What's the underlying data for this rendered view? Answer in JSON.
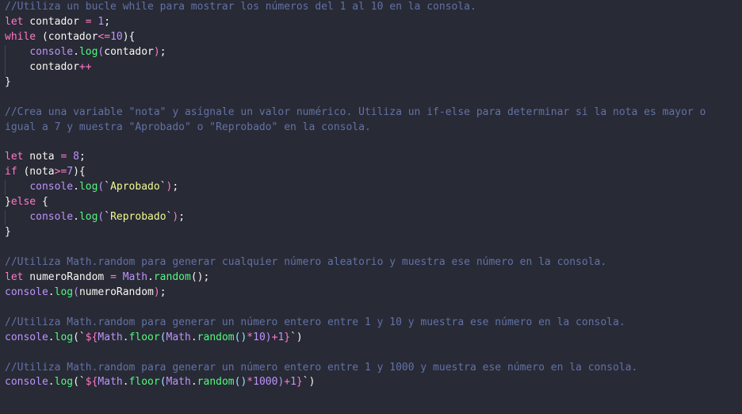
{
  "theme": {
    "background": "#282a36",
    "comment": "#6272a4",
    "keyword": "#ff79c6",
    "number": "#bd93f9",
    "function": "#50fa7b",
    "string": "#f1fa8c"
  },
  "lines": [
    [
      [
        "c",
        "//Utiliza un bucle while para mostrar los números del 1 al 10 en la consola."
      ]
    ],
    [
      [
        "k",
        "let"
      ],
      [
        "t",
        " contador "
      ],
      [
        "k",
        "="
      ],
      [
        "t",
        " "
      ],
      [
        "p",
        "1"
      ],
      [
        "t",
        ";"
      ]
    ],
    [
      [
        "k",
        "while"
      ],
      [
        "t",
        " (contador"
      ],
      [
        "k",
        "<="
      ],
      [
        "p",
        "10"
      ],
      [
        "t",
        "){"
      ]
    ],
    [
      [
        "t",
        "    "
      ],
      [
        "p",
        "console"
      ],
      [
        "t",
        "."
      ],
      [
        "f",
        "log"
      ],
      [
        "p",
        "("
      ],
      [
        "t",
        "contador"
      ],
      [
        "k",
        ")"
      ],
      [
        "t",
        ";"
      ]
    ],
    [
      [
        "t",
        "    contador"
      ],
      [
        "k",
        "++"
      ]
    ],
    [
      [
        "t",
        "}"
      ]
    ],
    [],
    [
      [
        "c",
        "//Crea una variable \"nota\" y asígnale un valor numérico. Utiliza un if-else para determinar si la nota es mayor o"
      ]
    ],
    [
      [
        "c",
        "igual a 7 y muestra \"Aprobado\" o \"Reprobado\" en la consola."
      ]
    ],
    [],
    [
      [
        "k",
        "let"
      ],
      [
        "t",
        " nota "
      ],
      [
        "k",
        "="
      ],
      [
        "t",
        " "
      ],
      [
        "p",
        "8"
      ],
      [
        "t",
        ";"
      ]
    ],
    [
      [
        "k",
        "if"
      ],
      [
        "t",
        " (nota"
      ],
      [
        "k",
        ">="
      ],
      [
        "p",
        "7"
      ],
      [
        "t",
        "){"
      ]
    ],
    [
      [
        "t",
        "    "
      ],
      [
        "p",
        "console"
      ],
      [
        "t",
        "."
      ],
      [
        "f",
        "log"
      ],
      [
        "p",
        "("
      ],
      [
        "t",
        "`"
      ],
      [
        "s",
        "Aprobado"
      ],
      [
        "t",
        "`"
      ],
      [
        "k",
        ")"
      ],
      [
        "t",
        ";"
      ]
    ],
    [
      [
        "t",
        "}"
      ],
      [
        "k",
        "else"
      ],
      [
        "t",
        " {"
      ]
    ],
    [
      [
        "t",
        "    "
      ],
      [
        "p",
        "console"
      ],
      [
        "t",
        "."
      ],
      [
        "f",
        "log"
      ],
      [
        "p",
        "("
      ],
      [
        "t",
        "`"
      ],
      [
        "s",
        "Reprobado"
      ],
      [
        "t",
        "`"
      ],
      [
        "k",
        ")"
      ],
      [
        "t",
        ";"
      ]
    ],
    [
      [
        "t",
        "}"
      ]
    ],
    [],
    [
      [
        "c",
        "//Utiliza Math.random para generar cualquier número aleatorio y muestra ese número en la consola."
      ]
    ],
    [
      [
        "k",
        "let"
      ],
      [
        "t",
        " numeroRandom "
      ],
      [
        "k",
        "="
      ],
      [
        "t",
        " "
      ],
      [
        "p",
        "Math"
      ],
      [
        "t",
        "."
      ],
      [
        "f",
        "random"
      ],
      [
        "t",
        "();"
      ]
    ],
    [
      [
        "p",
        "console"
      ],
      [
        "t",
        "."
      ],
      [
        "f",
        "log"
      ],
      [
        "p",
        "("
      ],
      [
        "t",
        "numeroRandom"
      ],
      [
        "k",
        ")"
      ],
      [
        "t",
        ";"
      ]
    ],
    [],
    [
      [
        "c",
        "//Utiliza Math.random para generar un número entero entre 1 y 10 y muestra ese número en la consola."
      ]
    ],
    [
      [
        "p",
        "console"
      ],
      [
        "t",
        "."
      ],
      [
        "f",
        "log"
      ],
      [
        "t",
        "(`"
      ],
      [
        "k",
        "${"
      ],
      [
        "p",
        "Math"
      ],
      [
        "t",
        "."
      ],
      [
        "f",
        "floor"
      ],
      [
        "q",
        "("
      ],
      [
        "p",
        "Math"
      ],
      [
        "t",
        "."
      ],
      [
        "f",
        "random"
      ],
      [
        "q",
        "()"
      ],
      [
        "k",
        "*"
      ],
      [
        "p",
        "10"
      ],
      [
        "p",
        ")"
      ],
      [
        "k",
        "+"
      ],
      [
        "p",
        "1"
      ],
      [
        "k",
        "}"
      ],
      [
        "t",
        "`)"
      ]
    ],
    [],
    [
      [
        "c",
        "//Utiliza Math.random para generar un número entero entre 1 y 1000 y muestra ese número en la consola."
      ]
    ],
    [
      [
        "p",
        "console"
      ],
      [
        "t",
        "."
      ],
      [
        "f",
        "log"
      ],
      [
        "t",
        "(`"
      ],
      [
        "k",
        "${"
      ],
      [
        "p",
        "Math"
      ],
      [
        "t",
        "."
      ],
      [
        "f",
        "floor"
      ],
      [
        "q",
        "("
      ],
      [
        "p",
        "Math"
      ],
      [
        "t",
        "."
      ],
      [
        "f",
        "random"
      ],
      [
        "q",
        "()"
      ],
      [
        "k",
        "*"
      ],
      [
        "p",
        "1000"
      ],
      [
        "p",
        ")"
      ],
      [
        "k",
        "+"
      ],
      [
        "p",
        "1"
      ],
      [
        "k",
        "}"
      ],
      [
        "t",
        "`)"
      ]
    ]
  ]
}
